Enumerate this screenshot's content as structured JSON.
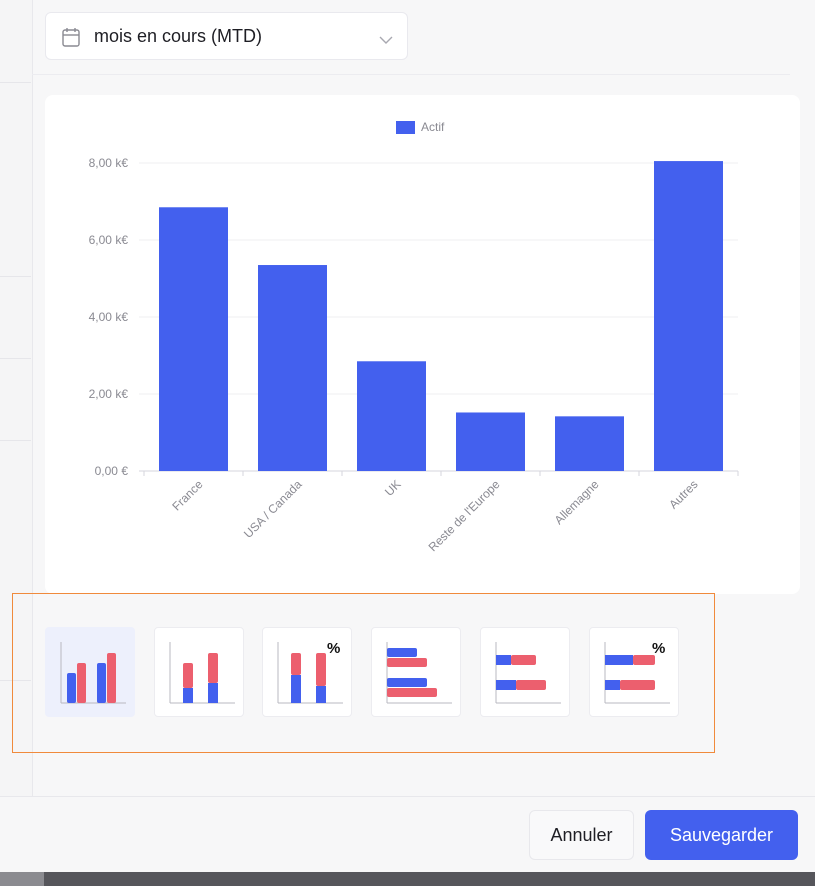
{
  "filter": {
    "date_range_label": "mois en cours (MTD)",
    "icon": "calendar-icon"
  },
  "chart_data": {
    "type": "bar",
    "categories": [
      "France",
      "USA / Canada",
      "UK",
      "Reste de l'Europe",
      "Allemagne",
      "Autres"
    ],
    "series": [
      {
        "name": "Actif",
        "color": "#4360ee",
        "values": [
          6.85,
          5.35,
          2.85,
          1.52,
          1.42,
          8.05
        ]
      }
    ],
    "ylim": [
      0,
      8
    ],
    "yticks": [
      0,
      2,
      4,
      6,
      8
    ],
    "ytick_labels": [
      "0,00 €",
      "2,00 k€",
      "4,00 k€",
      "6,00 k€",
      "8,00 k€"
    ],
    "title": "",
    "xlabel": "",
    "ylabel": "",
    "grid": true,
    "legend_position": "top-center"
  },
  "chart_types": [
    {
      "id": "grouped-columns",
      "icon": "grouped-columns-icon",
      "selected": true,
      "percent": ""
    },
    {
      "id": "stacked-columns",
      "icon": "stacked-columns-icon",
      "selected": false,
      "percent": ""
    },
    {
      "id": "stacked-columns-percent",
      "icon": "stacked-columns-percent-icon",
      "selected": false,
      "percent": "%"
    },
    {
      "id": "grouped-bars",
      "icon": "grouped-bars-icon",
      "selected": false,
      "percent": ""
    },
    {
      "id": "stacked-bars",
      "icon": "stacked-bars-icon",
      "selected": false,
      "percent": ""
    },
    {
      "id": "stacked-bars-percent",
      "icon": "stacked-bars-percent-icon",
      "selected": false,
      "percent": "%"
    }
  ],
  "colors": {
    "primary": "#4360ee",
    "secondary": "#ec5f6e",
    "highlight_border": "#f08a3c"
  },
  "actions": {
    "cancel_label": "Annuler",
    "save_label": "Sauvegarder"
  }
}
